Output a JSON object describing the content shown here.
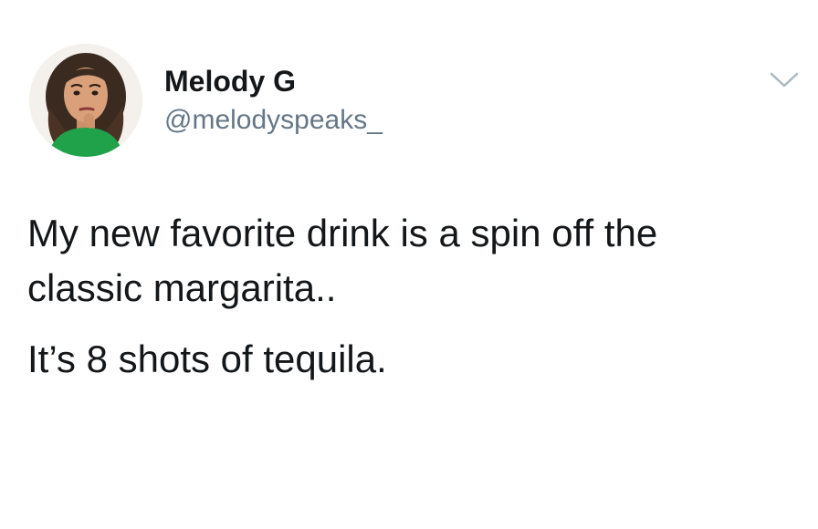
{
  "tweet": {
    "author": {
      "display_name": "Melody G",
      "handle": "@melodyspeaks_"
    },
    "icons": {
      "avatar": "profile-photo",
      "menu": "chevron-down-icon"
    },
    "text": {
      "line1": "My new favorite drink is a spin off the",
      "line2": "classic margarita..",
      "line3": "It’s 8 shots of tequila."
    }
  },
  "colors": {
    "text": "#14171a",
    "secondary_text": "#657786",
    "caret": "#aab8c2",
    "avatar_shirt": "#1fa24a"
  }
}
